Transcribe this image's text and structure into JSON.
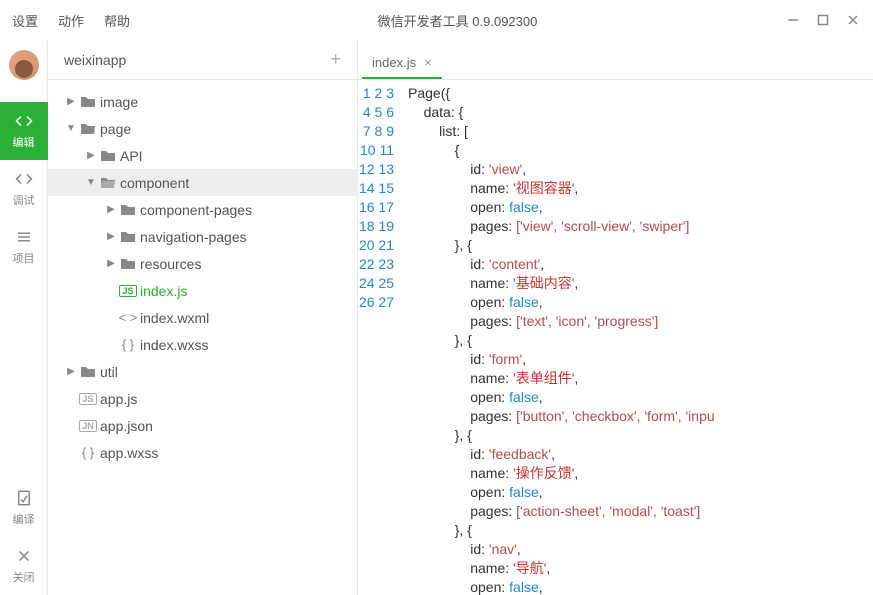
{
  "menu": {
    "settings": "设置",
    "actions": "动作",
    "help": "帮助"
  },
  "app_title": "微信开发者工具 0.9.092300",
  "sidebar": {
    "items": [
      {
        "label": "编辑",
        "active": true
      },
      {
        "label": "调试",
        "active": false
      },
      {
        "label": "项目",
        "active": false
      }
    ],
    "compile": "编译",
    "close": "关闭"
  },
  "project": {
    "name": "weixinapp"
  },
  "tree": {
    "image": "image",
    "page": "page",
    "api": "API",
    "component": "component",
    "component_pages": "component-pages",
    "navigation_pages": "navigation-pages",
    "resources": "resources",
    "index_js": "index.js",
    "index_wxml": "index.wxml",
    "index_wxss": "index.wxss",
    "util": "util",
    "app_js": "app.js",
    "app_json": "app.json",
    "app_wxss": "app.wxss"
  },
  "tab": {
    "label": "index.js"
  },
  "code": {
    "lines": [
      1,
      2,
      3,
      4,
      5,
      6,
      7,
      8,
      9,
      10,
      11,
      12,
      13,
      14,
      15,
      16,
      17,
      18,
      19,
      20,
      21,
      22,
      23,
      24,
      25,
      26,
      27
    ],
    "t_page": "Page",
    "t_data": "data",
    "t_list": "list",
    "t_id": "id",
    "t_name": "name",
    "t_open": "open",
    "t_pages": "pages",
    "t_false": "false",
    "v_view": "'view'",
    "v_view_cn": "'视图容器'",
    "v_view_pages": "['view', 'scroll-view', 'swiper']",
    "v_content": "'content'",
    "v_content_cn": "'基础内容'",
    "v_content_pages": "['text', 'icon', 'progress']",
    "v_form": "'form'",
    "v_form_cn": "'表单组件'",
    "v_form_pages": "['button', 'checkbox', 'form', 'inpu",
    "v_feedback": "'feedback'",
    "v_feedback_cn": "'操作反馈'",
    "v_feedback_pages": "['action-sheet', 'modal', 'toast']",
    "v_nav": "'nav'",
    "v_nav_cn": "'导航'"
  }
}
